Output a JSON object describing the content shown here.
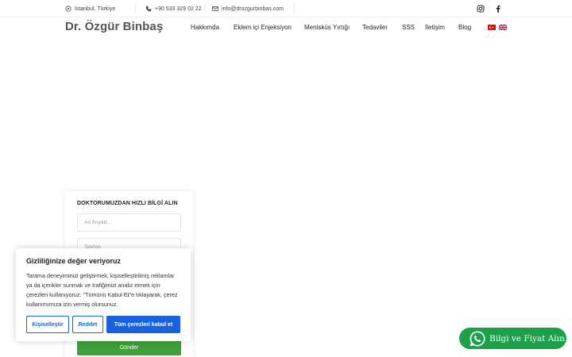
{
  "topbar": {
    "location": "İstanbul, Türkiye",
    "phone": "+90 533 329 02 22",
    "email": "info@drozgurbinbas.com"
  },
  "header": {
    "logo": "Dr. Özgür Binbaş",
    "nav": [
      "Hakkımda",
      "Eklem içi Enjeksiyon",
      "Menisküs Yırtığı",
      "Tedaviler",
      "SSS",
      "İletişim",
      "Blog"
    ]
  },
  "form": {
    "title": "DOKTORUMUZDAN HIZLI BİLGİ ALIN",
    "name_placeholder": "Ad Soyad...",
    "phone_placeholder": "Telefon",
    "submit_label": "Gönder"
  },
  "cookie": {
    "title": "Gizliliğinize değer veriyoruz",
    "text": "Tarama deneyiminizi geliştirmek, kişiselleştirilmiş reklamlar ya da içerikler sunmak ve trafiğimizi analiz etmek için çerezleri kullanıyoruz. \"Tümünü Kabul Et\"e tıklayarak, çerez kullanımımıza izin vermiş olursunuz.",
    "customize_label": "Kişiselleştir",
    "reject_label": "Reddet",
    "accept_label": "Tüm çerezleri kabul et"
  },
  "whatsapp": {
    "label": "Bilgi ve Fiyat Alın"
  },
  "colors": {
    "primary_blue": "#1863dc",
    "submit_green": "#3ea03a",
    "whatsapp_green": "#1aa14a"
  }
}
